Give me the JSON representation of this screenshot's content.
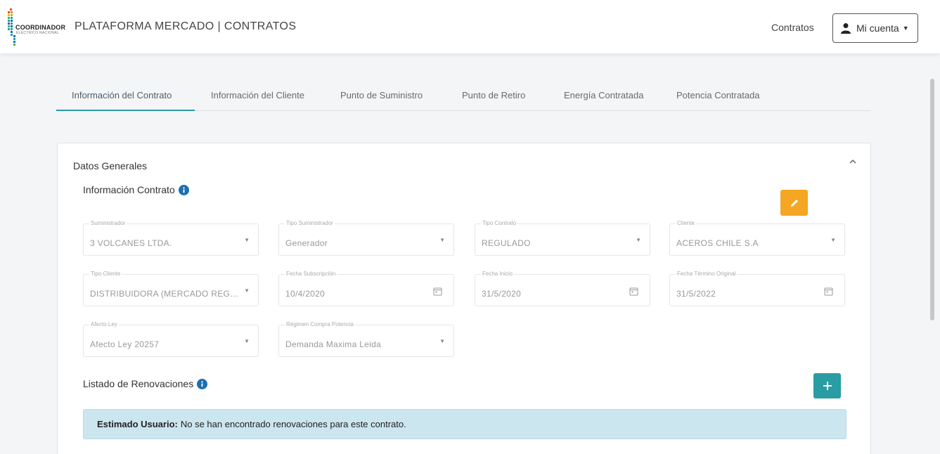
{
  "header": {
    "logo_text": "COORDINADOR",
    "logo_subtext": "ELÉCTRICO NACIONAL",
    "app_title": "PLATAFORMA MERCADO | CONTRATOS",
    "nav_link": "Contratos",
    "account_label": "Mi cuenta"
  },
  "tabs": [
    {
      "label": "Información del Contrato",
      "active": true
    },
    {
      "label": "Información del Cliente"
    },
    {
      "label": "Punto de Suministro"
    },
    {
      "label": "Punto de Retiro"
    },
    {
      "label": "Energía Contratada"
    },
    {
      "label": "Potencia Contratada"
    }
  ],
  "card": {
    "title": "Datos Generales",
    "section_title": "Información Contrato",
    "renewals_title": "Listado de Renovaciones"
  },
  "fields": {
    "suministrador": {
      "label": "Suministrador",
      "value": "3 VOLCANES LTDA."
    },
    "tipo_suministrador": {
      "label": "Tipo Suministrador",
      "value": "Generador"
    },
    "tipo_contrato": {
      "label": "Tipo Contrato",
      "value": "REGULADO"
    },
    "cliente": {
      "label": "Cliente",
      "value": "ACEROS CHILE S.A"
    },
    "tipo_cliente": {
      "label": "Tipo Cliente",
      "value": "DISTRIBUIDORA (MERCADO REGUL..."
    },
    "fecha_subscripcion": {
      "label": "Fecha Subscripción",
      "value": "10/4/2020"
    },
    "fecha_inicio": {
      "label": "Fecha Inicio",
      "value": "31/5/2020"
    },
    "fecha_termino": {
      "label": "Fecha Término Original",
      "value": "31/5/2022"
    },
    "afecto_ley": {
      "label": "Afecto Ley",
      "value": "Afecto Ley 20257"
    },
    "regimen": {
      "label": "Régimen Compra Potencia",
      "value": "Demanda Maxima Leida"
    }
  },
  "alert": {
    "strong": "Estimado Usuario:",
    "text": "No se han encontrado renovaciones para este contrato."
  },
  "colors": {
    "accent": "#2a9ca3",
    "edit": "#f5a623",
    "info": "#1a6fb0",
    "alert_bg": "#cce6ef"
  },
  "icons": {
    "user": "user-icon",
    "info": "info-icon",
    "edit": "pencil-icon",
    "add": "plus-icon",
    "calendar": "calendar-icon",
    "collapse": "chevron-up-icon"
  }
}
